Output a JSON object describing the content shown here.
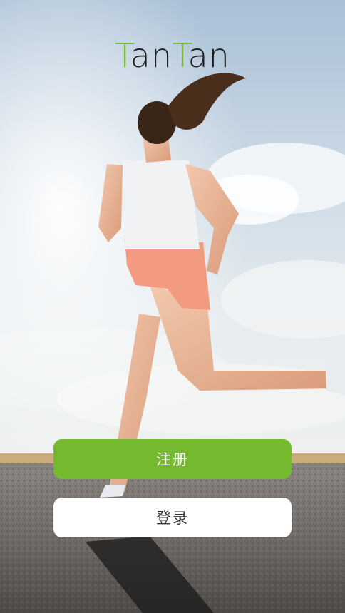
{
  "app": {
    "logo_part1": "T",
    "logo_part2": "an",
    "logo_part3": "T",
    "logo_part4": "an"
  },
  "actions": {
    "register_label": "注册",
    "login_label": "登录"
  },
  "colors": {
    "brand_green": "#74b92e",
    "logo_text": "#1c1c1c",
    "button_white": "#ffffff"
  },
  "background": {
    "image_description_icon": "runner-photo"
  }
}
